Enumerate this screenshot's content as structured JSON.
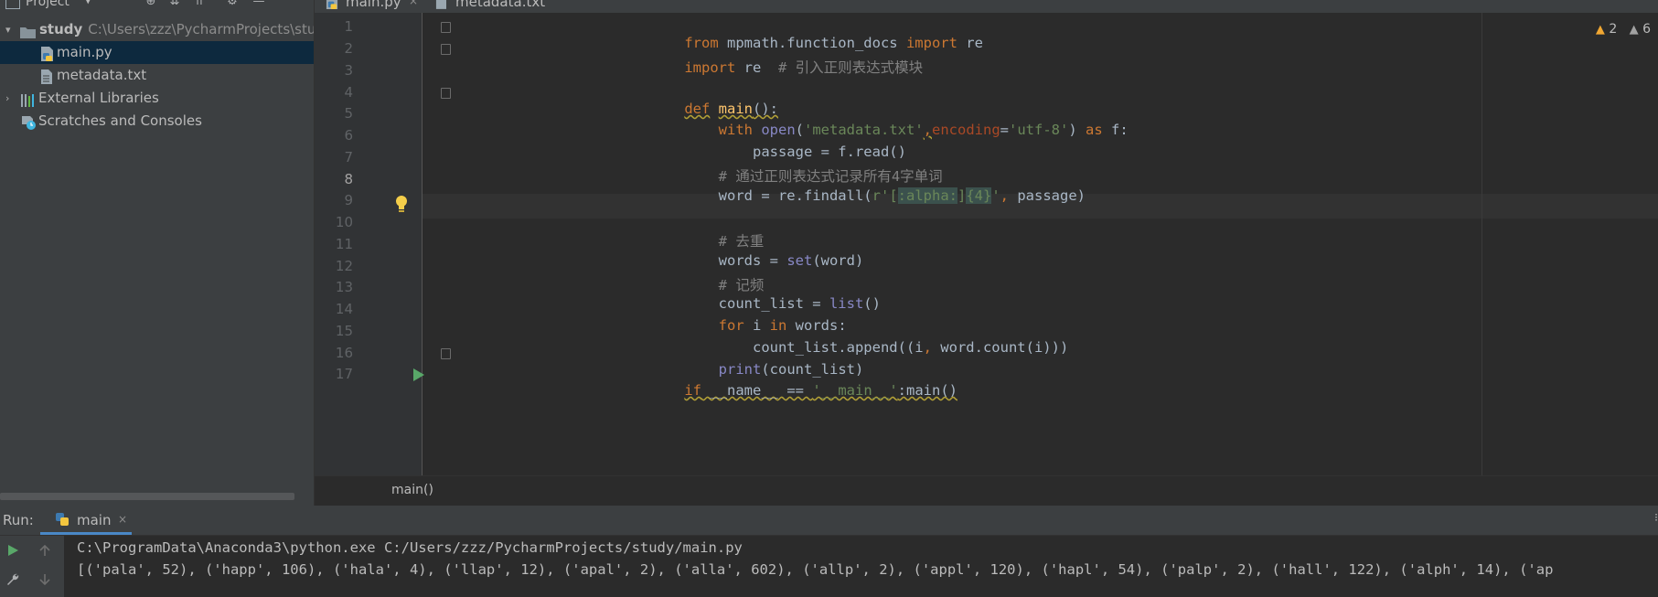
{
  "project_panel": {
    "title": "Project",
    "tree": [
      {
        "label": "study",
        "path": "C:\\Users\\zzz\\PycharmProjects\\stud",
        "type": "folder",
        "expanded": true
      },
      {
        "label": "main.py",
        "type": "python-file",
        "selected": true
      },
      {
        "label": "metadata.txt",
        "type": "text-file"
      },
      {
        "label": "External Libraries",
        "type": "libraries"
      },
      {
        "label": "Scratches and Consoles",
        "type": "scratches"
      }
    ]
  },
  "tabs": [
    {
      "label": "main.py",
      "active": true
    },
    {
      "label": "metadata.txt",
      "active": false
    }
  ],
  "editor": {
    "line_numbers": [
      "1",
      "2",
      "3",
      "4",
      "5",
      "6",
      "7",
      "8",
      "9",
      "10",
      "11",
      "12",
      "13",
      "14",
      "15",
      "16",
      "17"
    ],
    "current_line": "8",
    "inspections": {
      "warnings": "2",
      "weak_warnings": "6"
    },
    "code": {
      "l1a": "from",
      "l1b": " mpmath.function_docs ",
      "l1c": "import",
      "l1d": " re",
      "l2a": "import",
      "l2b": " re  ",
      "l2c": "# 引入正则表达式模块",
      "l4a": "def",
      "l4b": " ",
      "l4c": "main",
      "l4d": "():",
      "l5a": "    ",
      "l5b": "with",
      "l5c": " ",
      "l5d": "open",
      "l5e": "(",
      "l5f": "'metadata.txt'",
      "l5g": ",",
      "l5h": "encoding",
      "l5i": "=",
      "l5j": "'utf-8'",
      "l5k": ") ",
      "l5l": "as",
      "l5m": " f:",
      "l6": "        passage = f.read()",
      "l7": "    # 通过正则表达式记录所有4字单词",
      "l8a": "    word = re.findall(",
      "l8b": "r'",
      "l8c": "[",
      "l8d": ":alpha:",
      "l8e": "]",
      "l8f": "{4}",
      "l8g": "'",
      "l8h": ", ",
      "l8i": "passage)",
      "l10": "    # 去重",
      "l11a": "    words = ",
      "l11b": "set",
      "l11c": "(word)",
      "l12": "    # 记频",
      "l13a": "    count_list = ",
      "l13b": "list",
      "l13c": "()",
      "l14a": "    ",
      "l14b": "for",
      "l14c": " i ",
      "l14d": "in",
      "l14e": " words:",
      "l15a": "        count_list.append((i",
      "l15b": ", ",
      "l15c": "word.count(i)))",
      "l16a": "    ",
      "l16b": "print",
      "l16c": "(count_list)",
      "l17a": "if",
      "l17b": " __name__ == ",
      "l17c": "'__main__'",
      "l17d": ":main()"
    }
  },
  "breadcrumb": "main()",
  "run_panel": {
    "label": "Run:",
    "tab": "main",
    "close": "×",
    "console_lines": [
      "C:\\ProgramData\\Anaconda3\\python.exe C:/Users/zzz/PycharmProjects/study/main.py",
      "[('pala', 52), ('happ', 106), ('hala', 4), ('llap', 12), ('apal', 2), ('alla', 602), ('allp', 2), ('appl', 120), ('hapl', 54), ('palp', 2), ('hall', 122), ('alph', 14), ('ap"
    ]
  },
  "colors": {
    "background": "#2b2b2b",
    "panel": "#3c3f41",
    "keyword": "#cc7832",
    "string": "#6a8759",
    "comment": "#808080",
    "function": "#ffc66d",
    "builtin": "#8888c6",
    "selection": "#0d293e",
    "accent": "#4a88c7"
  }
}
